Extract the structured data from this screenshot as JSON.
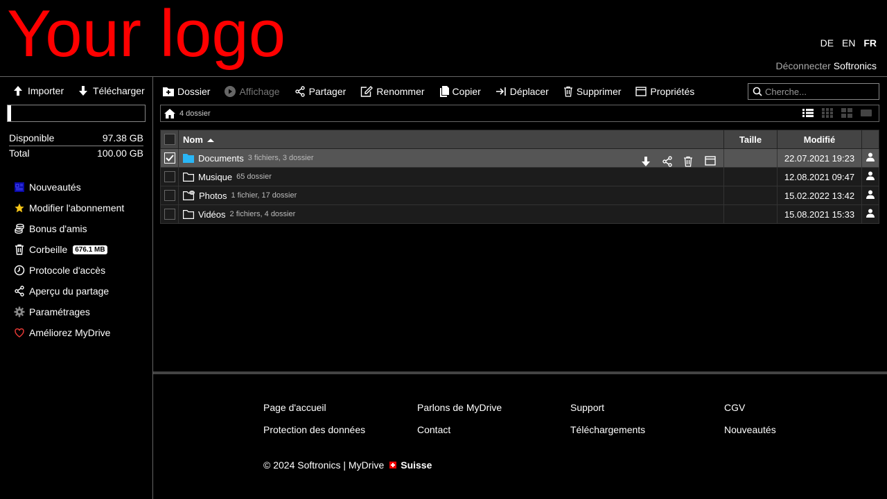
{
  "header": {
    "logo_text": "Your logo",
    "languages": [
      "DE",
      "EN",
      "FR"
    ],
    "active_language": "FR",
    "logout_label": "Déconnecter",
    "user_name": "Softronics"
  },
  "sidebar": {
    "import_label": "Importer",
    "download_label": "Télécharger",
    "quota_fraction": 0.0262,
    "available_label": "Disponible",
    "available_value": "97.38 GB",
    "total_label": "Total",
    "total_value": "100.00 GB",
    "nav": [
      {
        "label": "Nouveautés",
        "icon": "news-icon"
      },
      {
        "label": "Modifier l'abonnement",
        "icon": "star-icon"
      },
      {
        "label": "Bonus d'amis",
        "icon": "coins-icon"
      },
      {
        "label": "Corbeille",
        "icon": "trash-icon",
        "badge": "676.1 MB"
      },
      {
        "label": "Protocole d'accès",
        "icon": "clock-icon"
      },
      {
        "label": "Aperçu du partage",
        "icon": "share-icon"
      },
      {
        "label": "Paramétrages",
        "icon": "gear-icon"
      },
      {
        "label": "Améliorez MyDrive",
        "icon": "heart-icon"
      }
    ]
  },
  "toolbar": {
    "new_folder": "Dossier",
    "view": "Affichage",
    "share": "Partager",
    "rename": "Renommer",
    "copy": "Copier",
    "move": "Déplacer",
    "delete": "Supprimer",
    "properties": "Propriétés",
    "search_placeholder": "Cherche..."
  },
  "breadcrumb": {
    "text": "4 dossier"
  },
  "table": {
    "columns": {
      "name": "Nom",
      "size": "Taille",
      "modified": "Modifié"
    },
    "rows": [
      {
        "name": "Documents",
        "meta": "3 fichiers, 3 dossier",
        "size": "",
        "modified": "22.07.2021 19:23",
        "selected": true
      },
      {
        "name": "Musique",
        "meta": "65 dossier",
        "size": "",
        "modified": "12.08.2021 09:47",
        "selected": false
      },
      {
        "name": "Photos",
        "meta": "1 fichier, 17 dossier",
        "size": "",
        "modified": "15.02.2022 13:42",
        "selected": false
      },
      {
        "name": "Vidéos",
        "meta": "2 fichiers, 4 dossier",
        "size": "",
        "modified": "15.08.2021 15:33",
        "selected": false
      }
    ]
  },
  "footer": {
    "links": [
      "Page d'accueil",
      "Parlons de MyDrive",
      "Support",
      "CGV",
      "Protection des données",
      "Contact",
      "Téléchargements",
      "Nouveautés"
    ],
    "copyright": "© 2024 Softronics | MyDrive",
    "country": "Suisse"
  },
  "colors": {
    "logo": "#ff0000",
    "accent_folder": "#29b6f6",
    "background": "#000000"
  }
}
